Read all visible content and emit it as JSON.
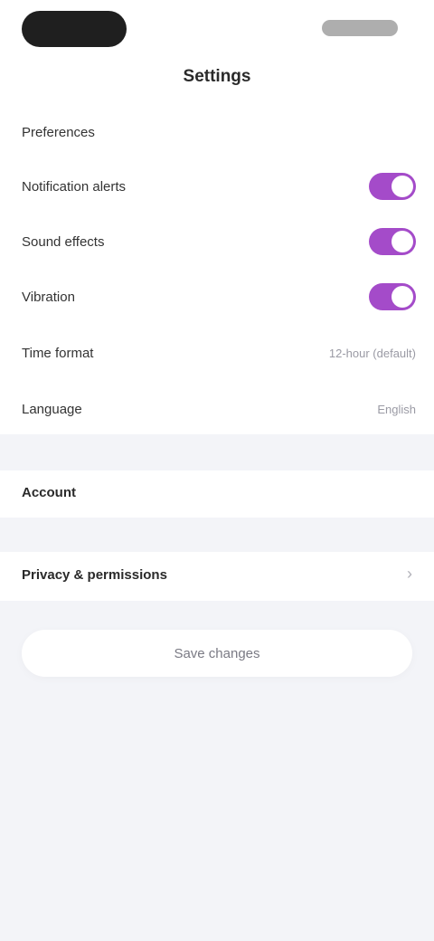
{
  "screen": {
    "title": "Settings"
  },
  "settings_group": {
    "heading": "Preferences",
    "items": [
      {
        "label": "Notification alerts",
        "type": "toggle",
        "on": true
      },
      {
        "label": "Sound effects",
        "type": "toggle",
        "on": true
      },
      {
        "label": "Vibration",
        "type": "toggle",
        "on": true
      },
      {
        "label": "Time format",
        "type": "value",
        "value": "12-hour (default)"
      },
      {
        "label": "Language",
        "type": "value",
        "value": "English"
      }
    ]
  },
  "sections": {
    "account_title": "Account",
    "privacy_title": "Privacy & permissions"
  },
  "actions": {
    "primary": "Save changes"
  },
  "colors": {
    "accent": "#a44bc9",
    "background": "#f3f4f8",
    "surface": "#ffffff"
  },
  "icons": {
    "status_left": "status-pill",
    "status_right": "status-indicators",
    "row_chevron": "chevron-right-icon"
  }
}
